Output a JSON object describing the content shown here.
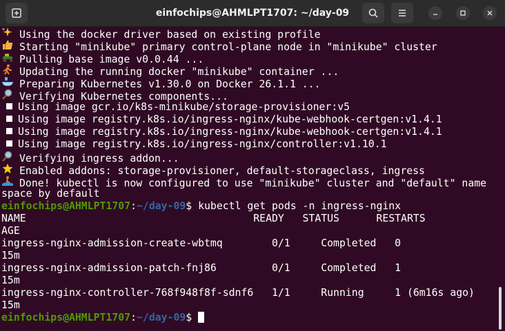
{
  "window": {
    "title": "einfochips@AHMLPT1707: ~/day-09"
  },
  "output": {
    "l1": "Using the docker driver based on existing profile",
    "l2": "Starting \"minikube\" primary control-plane node in \"minikube\" cluster",
    "l3": "Pulling base image v0.0.44 ...",
    "l4": "Updating the running docker \"minikube\" container ...",
    "l5": "Preparing Kubernetes v1.30.0 on Docker 26.1.1 ...",
    "l6": "Verifying Kubernetes components...",
    "l7": "Using image gcr.io/k8s-minikube/storage-provisioner:v5",
    "l8": "Using image registry.k8s.io/ingress-nginx/kube-webhook-certgen:v1.4.1",
    "l9": "Using image registry.k8s.io/ingress-nginx/kube-webhook-certgen:v1.4.1",
    "l10": "Using image registry.k8s.io/ingress-nginx/controller:v1.10.1",
    "l11": "Verifying ingress addon...",
    "l12": "Enabled addons: storage-provisioner, default-storageclass, ingress",
    "l13": "Done! kubectl is now configured to use \"minikube\" cluster and \"default\" name",
    "l14": "space by default"
  },
  "prompt": {
    "user_host": "einfochips@AHMLPT1707",
    "sep": ":",
    "path": "~/day-09",
    "dollar": "$ "
  },
  "command": "kubectl get pods -n ingress-nginx",
  "table": {
    "header": "NAME                                     READY   STATUS      RESTARTS",
    "header_wrap": "AGE",
    "rows": [
      {
        "line": "ingress-nginx-admission-create-wbtmq        0/1     Completed   0",
        "wrap": "15m"
      },
      {
        "line": "ingress-nginx-admission-patch-fnj86         0/1     Completed   1",
        "wrap": "15m"
      },
      {
        "line": "ingress-nginx-controller-768f948f8f-sdnf6   1/1     Running     1 (6m16s ago)",
        "wrap": "15m"
      }
    ]
  }
}
